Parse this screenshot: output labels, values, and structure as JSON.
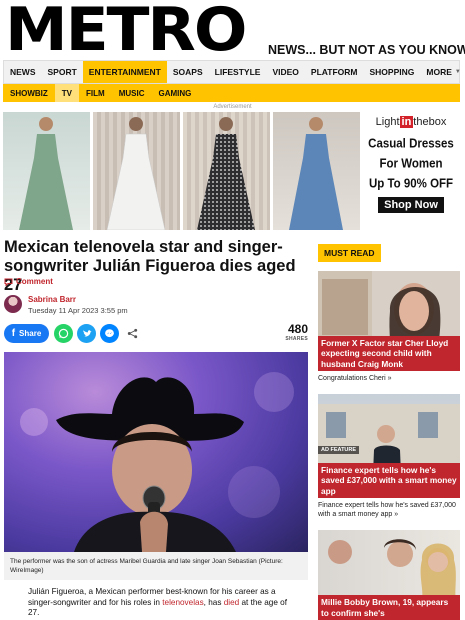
{
  "masthead": {
    "logo": "METRO",
    "tagline": "NEWS... BUT NOT AS YOU KNOW IT"
  },
  "nav": {
    "items": [
      "NEWS",
      "SPORT",
      "ENTERTAINMENT",
      "SOAPS",
      "LIFESTYLE",
      "VIDEO",
      "PLATFORM",
      "SHOPPING",
      "MORE"
    ],
    "active": "ENTERTAINMENT",
    "search_icon": "search-icon"
  },
  "subnav": {
    "items": [
      "SHOWBIZ",
      "TV",
      "FILM",
      "MUSIC",
      "GAMING"
    ],
    "active": "TV"
  },
  "ad": {
    "label": "Advertisement",
    "brand_left": "Light",
    "brand_mid": "in",
    "brand_right": "the",
    "brand_tail": "box",
    "line1": "Casual Dresses",
    "line2": "For Women",
    "line3": "Up To 90% OFF",
    "cta": "Shop Now",
    "dress_colors": [
      "#7fa58a",
      "#f2f2f0",
      "#2e2e30",
      "#5c86b8"
    ]
  },
  "article": {
    "headline": "Mexican telenovela star and singer-songwriter Julián Figueroa dies aged 27",
    "comment_label": "Comment",
    "author": "Sabrina Barr",
    "date": "Tuesday 11 Apr 2023 3:55 pm",
    "share_label": "Share",
    "shares_count": "480",
    "shares_label": "SHARES",
    "caption": "The performer was the son of actress Maribel Guardia and late singer Joan Sebastian (Picture: WireImage)",
    "body_pre": "Julián Figueroa, a Mexican performer best-known for his career as a singer-songwriter and for his roles in ",
    "body_link1": "telenovelas",
    "body_mid": ", has ",
    "body_link2": "died",
    "body_post": " at the age of 27."
  },
  "must_read": {
    "label": "MUST READ",
    "cards": [
      {
        "title": "Former X Factor star Cher Lloyd expecting second child with husband Craig Monk",
        "sub": "Congratulations Cheri »",
        "badge": ""
      },
      {
        "title": "Finance expert tells how he's saved £37,000 with a smart money app",
        "sub": "Finance expert tells how he's saved £37,000 with a smart money app »",
        "badge": "AD FEATURE"
      },
      {
        "title": "Millie Bobby Brown, 19, appears to confirm she's",
        "sub": "",
        "badge": ""
      }
    ]
  },
  "colors": {
    "brand_red": "#c0262d",
    "accent_yellow": "#ffc300",
    "facebook_blue": "#1877f2",
    "whatsapp_green": "#25d366",
    "twitter_blue": "#1da1f2",
    "messenger_blue": "#0084ff"
  }
}
